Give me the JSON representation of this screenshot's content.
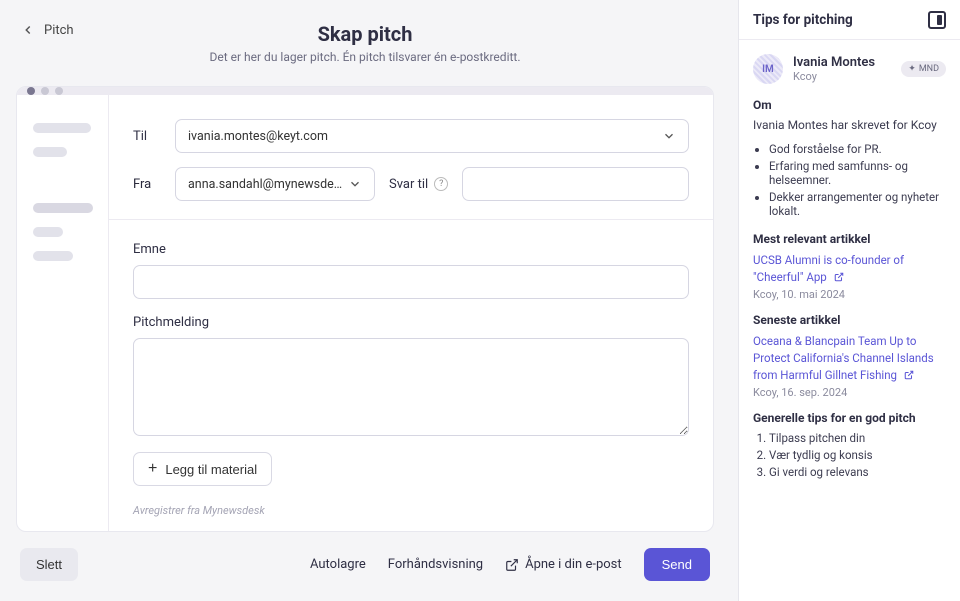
{
  "back_label": "Pitch",
  "header": {
    "title": "Skap pitch",
    "subtitle": "Det er her du lager pitch. Én pitch tilsvarer én e-postkreditt."
  },
  "form": {
    "to_label": "Til",
    "to_value": "ivania.montes@keyt.com",
    "from_label": "Fra",
    "from_value": "anna.sandahl@mynewsdesk.com <he",
    "reply_to_label": "Svar til",
    "reply_to_value": "",
    "subject_label": "Emne",
    "subject_value": "",
    "body_label": "Pitchmelding",
    "body_value": "",
    "add_material": "Legg til material",
    "unregister": "Avregistrer fra Mynewsdesk"
  },
  "footer": {
    "delete": "Slett",
    "autosave": "Autolagre",
    "preview": "Forhåndsvisning",
    "open_in_email": "Åpne i din e-post",
    "send": "Send"
  },
  "sidebar": {
    "title": "Tips for pitching",
    "profile": {
      "initials": "IM",
      "name": "Ivania Montes",
      "org": "Kcoy",
      "badge": "MND"
    },
    "about_heading": "Om",
    "about_text": "Ivania Montes har skrevet for Kcoy",
    "bullets": [
      "God forståelse for PR.",
      "Erfaring med samfunns- og helseemner.",
      "Dekker arrangementer og nyheter lokalt."
    ],
    "most_relevant_heading": "Mest relevant artikkel",
    "most_relevant_title": "UCSB Alumni is co-founder of \"Cheerful\" App",
    "most_relevant_meta": "Kcoy, 10. mai 2024",
    "latest_heading": "Seneste artikkel",
    "latest_title": "Oceana & Blancpain Team Up to Protect California's Channel Islands from Harmful Gillnet Fishing",
    "latest_meta": "Kcoy, 16. sep. 2024",
    "general_tips_heading": "Generelle tips for en god pitch",
    "tips": [
      "Tilpass pitchen din",
      "Vær tydlig og konsis",
      "Gi verdi og relevans"
    ]
  }
}
